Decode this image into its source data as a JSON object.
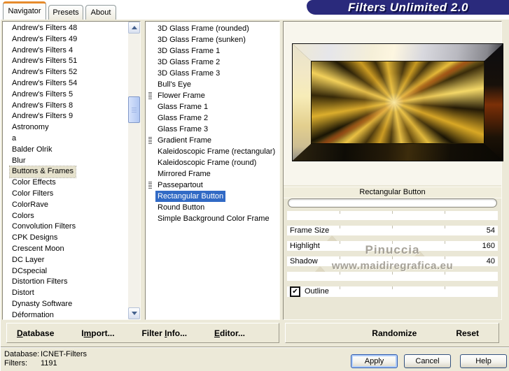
{
  "window": {
    "title": "Filters Unlimited 2.0"
  },
  "tabs": [
    {
      "label": "Navigator",
      "active": true
    },
    {
      "label": "Presets",
      "active": false
    },
    {
      "label": "About",
      "active": false
    }
  ],
  "category_list": {
    "selected": "Buttons & Frames",
    "items": [
      "Andrew's Filters 48",
      "Andrew's Filters 49",
      "Andrew's Filters 4",
      "Andrew's Filters 51",
      "Andrew's Filters 52",
      "Andrew's Filters 54",
      "Andrew's Filters 5",
      "Andrew's Filters 8",
      "Andrew's Filters 9",
      "Astronomy",
      "a",
      "Balder Olrik",
      "Blur",
      "Buttons & Frames",
      "Color Effects",
      "Color Filters",
      "ColorRave",
      "Colors",
      "Convolution Filters",
      "CPK Designs",
      "Crescent Moon",
      "DC Layer",
      "DCspecial",
      "Distortion Filters",
      "Distort",
      "Dynasty Software",
      "Déformation"
    ]
  },
  "filter_list": {
    "selected": "Rectangular Button",
    "items": [
      {
        "label": "3D Glass Frame (rounded)",
        "icon": false
      },
      {
        "label": "3D Glass Frame (sunken)",
        "icon": false
      },
      {
        "label": "3D Glass Frame 1",
        "icon": false
      },
      {
        "label": "3D Glass Frame 2",
        "icon": false
      },
      {
        "label": "3D Glass Frame 3",
        "icon": false
      },
      {
        "label": "Bull's Eye",
        "icon": false
      },
      {
        "label": "Flower Frame",
        "icon": true
      },
      {
        "label": "Glass Frame 1",
        "icon": false
      },
      {
        "label": "Glass Frame 2",
        "icon": false
      },
      {
        "label": "Glass Frame 3",
        "icon": false
      },
      {
        "label": "Gradient Frame",
        "icon": true
      },
      {
        "label": "Kaleidoscopic Frame (rectangular)",
        "icon": false
      },
      {
        "label": "Kaleidoscopic Frame (round)",
        "icon": false
      },
      {
        "label": "Mirrored Frame",
        "icon": false
      },
      {
        "label": "Passepartout",
        "icon": true
      },
      {
        "label": "Rectangular Button",
        "icon": false
      },
      {
        "label": "Round Button",
        "icon": false
      },
      {
        "label": "Simple Background Color Frame",
        "icon": false
      }
    ]
  },
  "preview": {
    "filter_name": "Rectangular Button",
    "progress_value": 0
  },
  "slider_range": {
    "min": 0,
    "max": 255
  },
  "sliders": [
    {
      "label": "Frame Size",
      "value": 54
    },
    {
      "label": "Highlight",
      "value": 160
    },
    {
      "label": "Shadow",
      "value": 40
    }
  ],
  "checkbox": {
    "label": "Outline",
    "checked": true
  },
  "watermark": {
    "line1": "Pinuccia",
    "line2": "www.maidiregrafica.eu"
  },
  "toolbar": {
    "database": {
      "pre": "",
      "key": "D",
      "post": "atabase"
    },
    "import": {
      "pre": "I",
      "key": "m",
      "post": "port..."
    },
    "filter_info": {
      "pre": "Filter ",
      "key": "I",
      "post": "nfo..."
    },
    "editor": {
      "pre": "",
      "key": "E",
      "post": "ditor..."
    },
    "randomize": "Randomize",
    "reset": "Reset"
  },
  "status": {
    "database_label": "Database:",
    "database_value": "ICNET-Filters",
    "filters_label": "Filters:",
    "filters_value": "1191"
  },
  "actions": [
    {
      "label": "Apply",
      "default": true
    },
    {
      "label": "Cancel",
      "default": false
    },
    {
      "label": "Help",
      "default": false
    }
  ],
  "colors": {
    "selection_blue": "#316ac5",
    "inactive_selection": "#e6e2cd",
    "title_navy": "#2a2a7c",
    "tab_accent_orange": "#e68b2c",
    "dialog_beige": "#ece9d8"
  }
}
